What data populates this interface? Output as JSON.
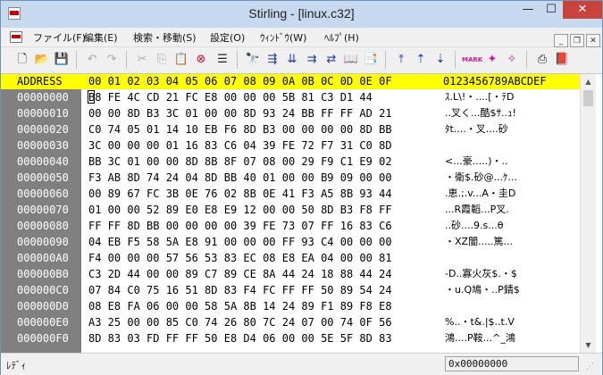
{
  "window": {
    "title": "Stirling - [linux.c32]"
  },
  "caption": {
    "minimize": "—",
    "maximize": "☐",
    "close": "✕"
  },
  "menu": {
    "items": [
      {
        "label": "ファイル(F)"
      },
      {
        "label": "編集(E)"
      },
      {
        "label": "検索・移動(S)"
      },
      {
        "label": "設定(O)"
      },
      {
        "label": "ｳｨﾝﾄﾞｳ(W)"
      },
      {
        "label": "ﾍﾙﾌﾟ(H)"
      }
    ],
    "mdi": {
      "minimize": "_",
      "restore": "❐",
      "close": "✕"
    }
  },
  "toolbar": {
    "icons": [
      "new-file-icon",
      "open-folder-icon",
      "save-icon",
      "undo-icon",
      "redo-icon",
      "cut-icon",
      "copy-icon",
      "paste-icon",
      "delete-icon",
      "justify-icon",
      "find-icon",
      "find-next-icon",
      "find-down-icon",
      "find-replace-icon",
      "find-ab-icon",
      "compare-icon",
      "compare-next-icon",
      "goto-start-icon",
      "goto-up-icon",
      "goto-down-icon",
      "mark-icon",
      "mark-next-icon",
      "mark-prev-icon",
      "print-icon",
      "help-book-icon"
    ],
    "mark_text": "MARK"
  },
  "header": {
    "address": "ADDRESS",
    "columns": "00 01 02 03 04 05 06 07 08 09 0A 0B 0C 0D 0E 0F",
    "ascii": "0123456789ABCDEF"
  },
  "rows": [
    {
      "addr": "00000000",
      "hex": "B8 FE 4C CD 21 FC E8 00 00 00 5B 81 C3 D1 44",
      "text": "ｽ.L\\!・....[・ﾃD"
    },
    {
      "addr": "00000010",
      "hex": "00 00 8D B3 3C 01 00 00 8D 93 24 BB FF FF AD 21",
      "text": "..叉く...酷$ｻ..ｭ!"
    },
    {
      "addr": "00000020",
      "hex": "C0 74 05 01 14 10 EB F6 8D B3 00 00 00 00 8D BB",
      "text": "ﾀt....・叉....砂"
    },
    {
      "addr": "00000030",
      "hex": "3C 00 00 00 01 16 83 C6 04 39 FE 72 F7 31 C0 8D",
      "text": ""
    },
    {
      "addr": "00000040",
      "hex": "BB 3C 01 00 00 8D 8B 8F 07 08 00 29 F9 C1 E9 02",
      "text": "<...豪.....)・.."
    },
    {
      "addr": "00000050",
      "hex": "F3 AB 8D 74 24 04 8D BB 40 01 00 00 B9 09 00 00",
      "text": "・衛$.砂@...ｹ..."
    },
    {
      "addr": "00000060",
      "hex": "00 89 67 FC 3B 0E 76 02 8B 0E 41 F3 A5 8B 93 44",
      "text": ".恵.;.v...A・圭D"
    },
    {
      "addr": "00000070",
      "hex": "01 00 00 52 89 E0 E8 E9 12 00 00 50 8D B3 F8 FF",
      "text": "...R霞韜...P叉."
    },
    {
      "addr": "00000080",
      "hex": "FF FF 8D BB 00 00 00 00 39 FE 73 07 FF 16 83 C6",
      "text": "..砂....9.s...θ"
    },
    {
      "addr": "00000090",
      "hex": "04 EB F5 58 5A E8 91 00 00 00 FF 93 C4 00 00 00",
      "text": "・XZ闇.....篤..."
    },
    {
      "addr": "000000A0",
      "hex": "F4 00 00 00 57 56 53 83 EC 08 E8 EA 04 00 00 81",
      "text": ""
    },
    {
      "addr": "000000B0",
      "hex": "C3 2D 44 00 00 89 C7 89 CE 8A 44 24 18 88 44 24",
      "text": "-D..寡火灰$.・$"
    },
    {
      "addr": "000000C0",
      "hex": "07 84 C0 75 16 51 8D 83 F4 FC FF FF 50 89 54 24",
      "text": "・u.Q鳩・..P錆$"
    },
    {
      "addr": "000000D0",
      "hex": "08 E8 FA 06 00 00 58 5A 8B 14 24 89 F1 89 F8 E8",
      "text": ""
    },
    {
      "addr": "000000E0",
      "hex": "A3 25 00 00 85 C0 74 26 80 7C 24 07 00 74 0F 56",
      "text": "%..・t&.|$..t.V"
    },
    {
      "addr": "000000F0",
      "hex": "8D 83 03 FD FF FF 50 E8 D4 06 00 00 5E 5F 8D 83",
      "text": "鴻....P鞍...^_鴻"
    }
  ],
  "status": {
    "text": "ﾚﾃﾞｨ",
    "position": "0x00000000"
  }
}
